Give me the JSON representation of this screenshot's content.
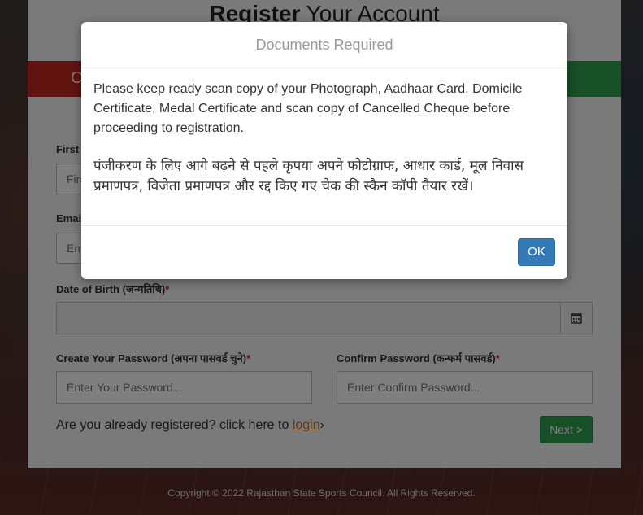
{
  "page": {
    "title_bold": "Register",
    "title_rest": " Your Account",
    "band_label": "C"
  },
  "form": {
    "first_name_label": "First",
    "first_name_placeholder": "Firs",
    "email_label": "Emai",
    "email_placeholder": "Em",
    "dob_label": "Date of Birth (जन्मतिथि)",
    "dob_value": "",
    "password_label": "Create Your Password (अपना पासवर्ड चुने)",
    "password_placeholder": "Enter Your Password...",
    "confirm_label": "Confirm Password (कन्फर्म पासवर्ड)",
    "confirm_placeholder": "Enter Confirm Password...",
    "required_mark": "*",
    "calendar_icon": "calendar-icon"
  },
  "login": {
    "prompt": "Are you already registered? click here to ",
    "link": "login",
    "suffix": "›"
  },
  "next_button": "Next >",
  "footer": "Copyright © 2022 Rajasthan State Sports Council. All Rights Reserved.",
  "modal": {
    "title": "Documents Required",
    "text_en": "Please keep ready scan copy of your Photograph, Aadhaar Card, Domicile Certificate, Medal Certificate and scan copy of Cancelled Cheque before proceeding to registration.",
    "text_hi": "पंजीकरण के लिए आगे बढ़ने से पहले कृपया अपने फोटोग्राफ, आधार कार्ड, मूल निवास प्रमाणपत्र, विजेता प्रमाणपत्र और रद्द किए गए चेक की स्कैन कॉपी तैयार रखें।",
    "ok_label": "OK"
  },
  "colors": {
    "accent_red": "#c0261f",
    "accent_green": "#2e9e4f",
    "ok_blue": "#337ab7",
    "link_orange": "#d07a1a"
  }
}
